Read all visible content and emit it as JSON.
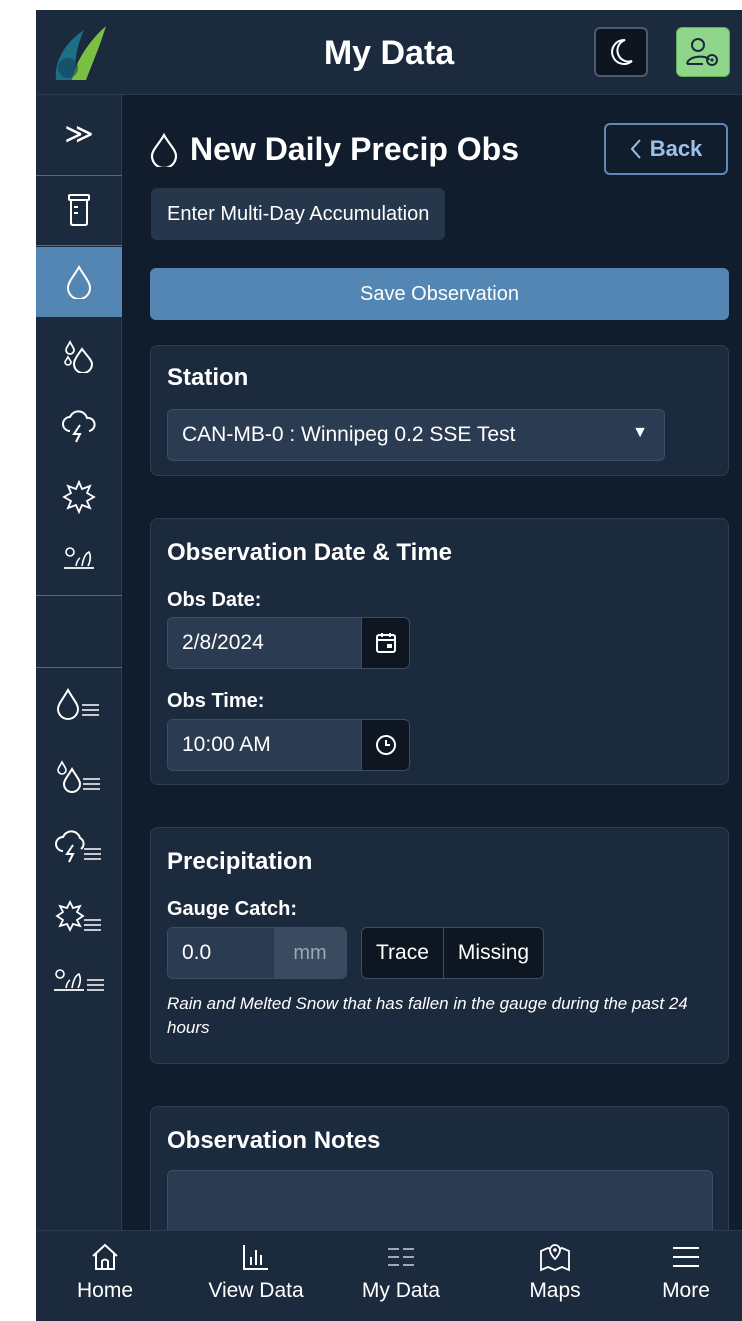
{
  "header": {
    "title": "My Data",
    "logo_icon": "raindrop-logo",
    "theme_icon": "moon-icon",
    "user_icon": "user-settings-icon"
  },
  "sidebar": {
    "items": [
      {
        "icon": "expand-chevrons-icon",
        "glyph": "≫"
      },
      {
        "icon": "rain-gauge-icon"
      },
      {
        "icon": "raindrop-icon",
        "active": true
      },
      {
        "icon": "multi-drops-icon"
      },
      {
        "icon": "storm-cloud-icon"
      },
      {
        "icon": "hail-icon"
      },
      {
        "icon": "condition-icon"
      },
      {
        "icon": "raindrop-list-icon"
      },
      {
        "icon": "multi-drops-list-icon"
      },
      {
        "icon": "storm-cloud-list-icon"
      },
      {
        "icon": "hail-list-icon"
      },
      {
        "icon": "condition-list-icon"
      }
    ]
  },
  "page": {
    "title": "New Daily Precip Obs",
    "back_label": "Back",
    "multiday_label": "Enter Multi-Day Accumulation",
    "save_label": "Save Observation"
  },
  "station": {
    "title": "Station",
    "selected": "CAN-MB-0 : Winnipeg 0.2 SSE Test"
  },
  "datetime": {
    "title": "Observation Date & Time",
    "date_label": "Obs Date:",
    "date_value": "2/8/2024",
    "time_label": "Obs Time:",
    "time_value": "10:00 AM"
  },
  "precip": {
    "title": "Precipitation",
    "gauge_label": "Gauge Catch:",
    "gauge_value": "0.0",
    "unit": "mm",
    "trace_label": "Trace",
    "missing_label": "Missing",
    "help": "Rain and Melted Snow that has fallen in the gauge during the past 24 hours"
  },
  "notes": {
    "title": "Observation Notes",
    "value": ""
  },
  "bottom_nav": {
    "items": [
      {
        "label": "Home",
        "icon": "home-icon"
      },
      {
        "label": "View Data",
        "icon": "bar-chart-icon"
      },
      {
        "label": "My Data",
        "icon": "list-icon"
      },
      {
        "label": "Maps",
        "icon": "map-icon"
      },
      {
        "label": "More",
        "icon": "menu-icon"
      }
    ]
  },
  "colors": {
    "background": "#111c2d",
    "panel": "#1c2a3d",
    "accent": "#5486b3",
    "user_button": "#8fd58a"
  }
}
